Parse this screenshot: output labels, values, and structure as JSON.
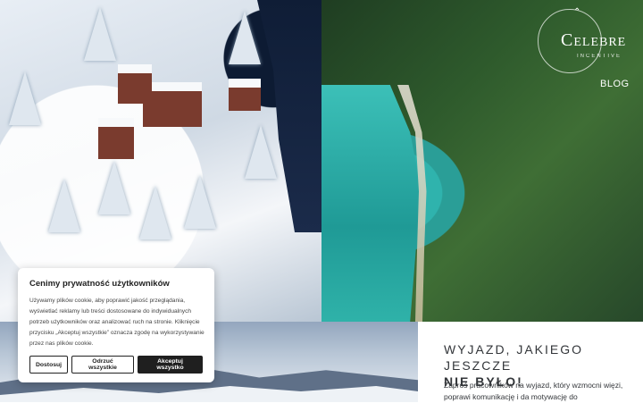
{
  "logo": {
    "wordmark": "Celebre",
    "subtitle": "INCENTIVE",
    "bird_icon": "bird-icon"
  },
  "nav": {
    "blog_label": "BLOG"
  },
  "intro": {
    "heading_line1": "WYJAZD, JAKIEGO JESZCZE",
    "heading_line2": "NIE BYŁO!",
    "text": "Zaproś pracowników na wyjazd, który wzmocni więzi, poprawi komunikację i da motywację do"
  },
  "cookie": {
    "title": "Cenimy prywatność użytkowników",
    "text": "Używamy plików cookie, aby poprawić jakość przeglądania, wyświetlać reklamy lub treści dostosowane do indywidualnych potrzeb użytkowników oraz analizować ruch na stronie. Kliknięcie przycisku „Akceptuj wszystkie” oznacza zgodę na wykorzystywanie przez nas plików cookie.",
    "customize_label": "Dostosuj",
    "reject_label": "Odrzuć wszystkie",
    "accept_label": "Akceptuj wszystko"
  },
  "colors": {
    "accent": "#1f1f1f",
    "text": "#33363a",
    "banner_bg": "#ffffff"
  }
}
